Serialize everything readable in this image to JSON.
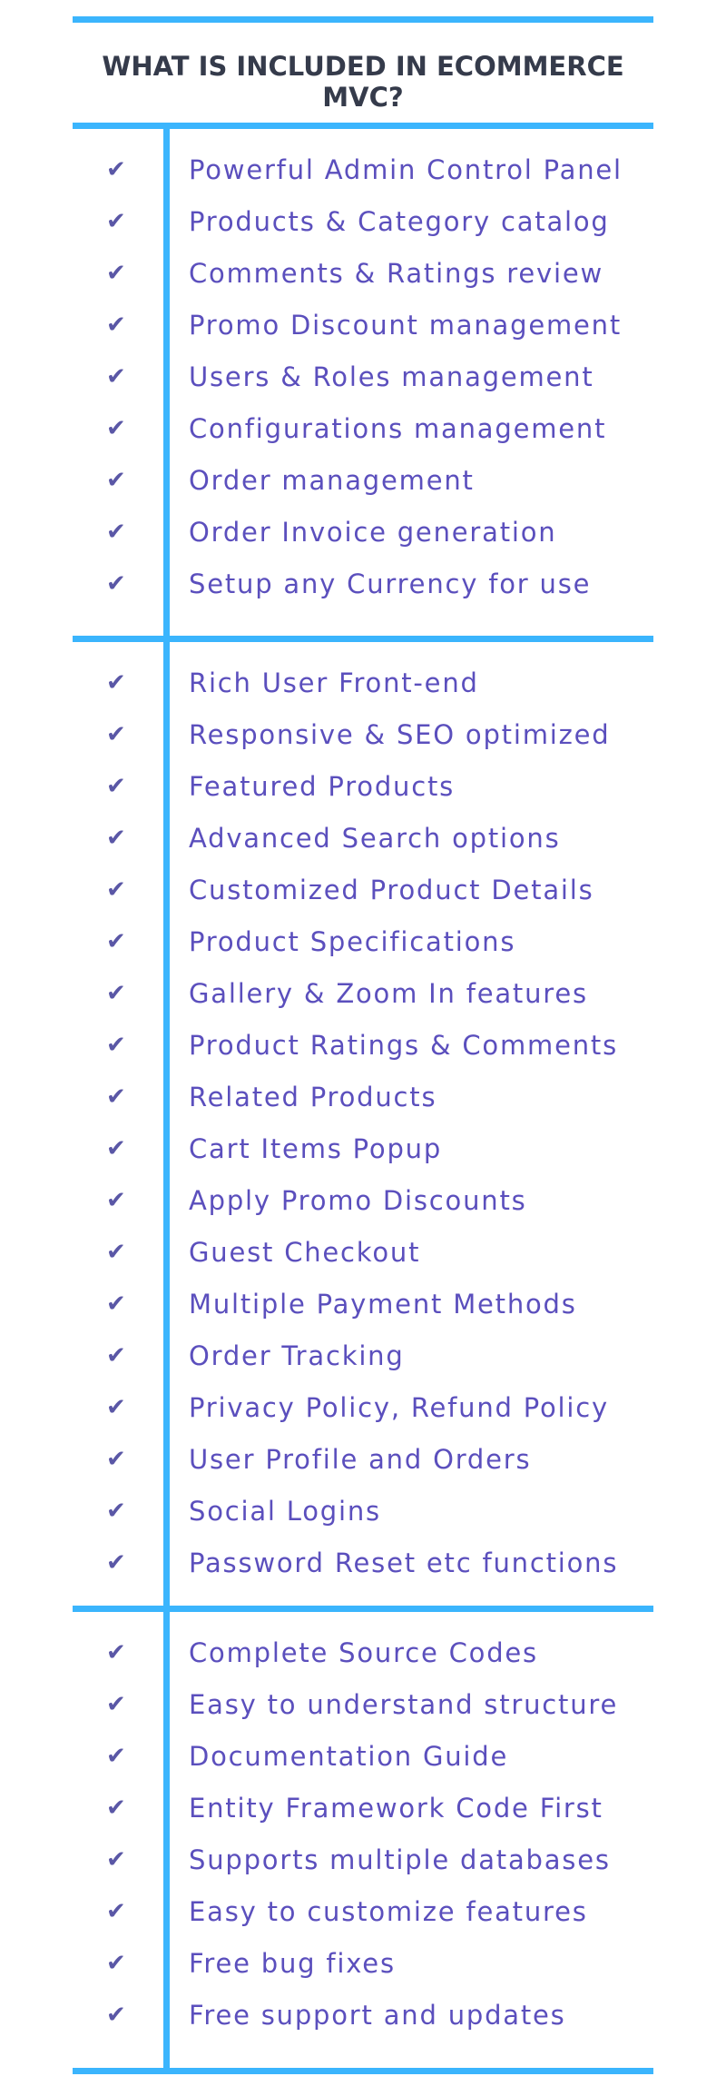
{
  "title": "WHAT IS INCLUDED IN ECOMMERCE MVC?",
  "check_icon": "✔",
  "sections": [
    {
      "items": [
        "Powerful Admin Control Panel",
        "Products & Category catalog",
        "Comments & Ratings review",
        "Promo Discount management",
        "Users & Roles management",
        "Configurations management",
        "Order management",
        "Order Invoice generation",
        "Setup any Currency for use"
      ]
    },
    {
      "items": [
        "Rich User Front-end",
        "Responsive & SEO optimized",
        "Featured Products",
        "Advanced Search options",
        "Customized Product Details",
        "Product Specifications",
        "Gallery & Zoom In features",
        "Product Ratings & Comments",
        "Related Products",
        "Cart Items Popup",
        "Apply Promo Discounts",
        "Guest Checkout",
        "Multiple Payment Methods",
        "Order Tracking",
        "Privacy Policy, Refund Policy",
        "User Profile and Orders",
        "Social Logins",
        "Password Reset etc functions"
      ]
    },
    {
      "items": [
        "Complete Source Codes",
        "Easy to understand structure",
        "Documentation Guide",
        "Entity Framework Code First",
        "Supports multiple databases",
        "Easy to customize features",
        "Free bug fixes",
        "Free support and updates"
      ]
    }
  ],
  "colors": {
    "accent": "#3bb5fd",
    "heading": "#353b4b",
    "item_text": "#5b4fbd"
  }
}
